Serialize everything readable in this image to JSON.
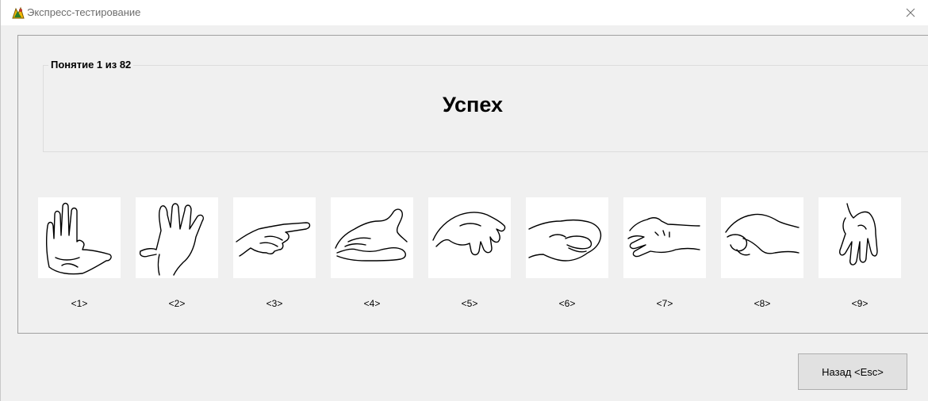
{
  "window": {
    "title": "Экспресс-тестирование"
  },
  "concept": {
    "caption": "Понятие 1 из 82",
    "word": "Успех"
  },
  "hands": [
    {
      "label": "<1>",
      "icon": "open-palm-hand-icon"
    },
    {
      "label": "<2>",
      "icon": "spread-fingers-hand-icon"
    },
    {
      "label": "<3>",
      "icon": "pointing-hand-icon"
    },
    {
      "label": "<4>",
      "icon": "cupped-hand-icon"
    },
    {
      "label": "<5>",
      "icon": "palm-down-hand-icon"
    },
    {
      "label": "<6>",
      "icon": "fist-hand-icon"
    },
    {
      "label": "<7>",
      "icon": "flat-hand-icon"
    },
    {
      "label": "<8>",
      "icon": "pinch-hand-icon"
    },
    {
      "label": "<9>",
      "icon": "hanging-hand-icon"
    }
  ],
  "buttons": {
    "back": "Назад <Esc>"
  }
}
